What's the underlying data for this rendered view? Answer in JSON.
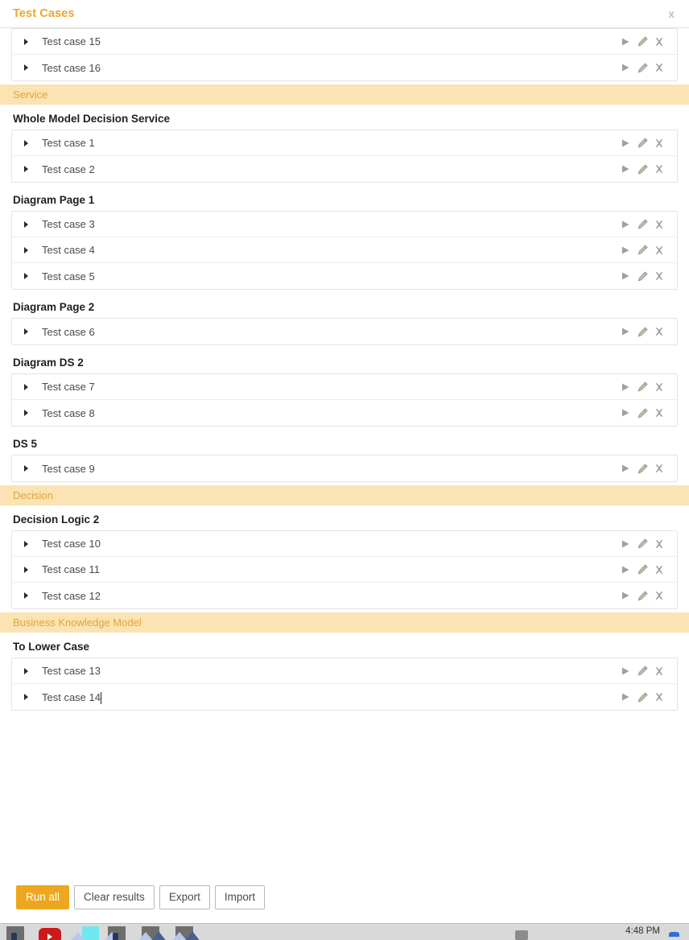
{
  "panel": {
    "title": "Test Cases",
    "close_label": "x"
  },
  "top_cases": [
    {
      "name": "Test case 15",
      "editing": false
    },
    {
      "name": "Test case 16",
      "editing": false
    }
  ],
  "row_actions": {
    "run": "run-icon",
    "edit": "edit-icon",
    "delete": "delete-icon"
  },
  "sections": [
    {
      "category": "Service",
      "groups": [
        {
          "heading": "Whole Model Decision Service",
          "cases": [
            {
              "name": "Test case 1",
              "editing": false
            },
            {
              "name": "Test case 2",
              "editing": false
            }
          ]
        },
        {
          "heading": "Diagram Page 1",
          "cases": [
            {
              "name": "Test case 3",
              "editing": false
            },
            {
              "name": "Test case 4",
              "editing": false
            },
            {
              "name": "Test case 5",
              "editing": false
            }
          ]
        },
        {
          "heading": "Diagram Page 2",
          "cases": [
            {
              "name": "Test case 6",
              "editing": false
            }
          ]
        },
        {
          "heading": "Diagram DS 2",
          "cases": [
            {
              "name": "Test case 7",
              "editing": false
            },
            {
              "name": "Test case 8",
              "editing": false
            }
          ]
        },
        {
          "heading": "DS 5",
          "cases": [
            {
              "name": "Test case 9",
              "editing": false
            }
          ]
        }
      ]
    },
    {
      "category": "Decision",
      "groups": [
        {
          "heading": "Decision Logic 2",
          "cases": [
            {
              "name": "Test case 10",
              "editing": false
            },
            {
              "name": "Test case 11",
              "editing": false
            },
            {
              "name": "Test case 12",
              "editing": false
            }
          ]
        }
      ]
    },
    {
      "category": "Business Knowledge Model",
      "groups": [
        {
          "heading": "To Lower Case",
          "cases": [
            {
              "name": "Test case 13",
              "editing": false
            },
            {
              "name": "Test case 14",
              "editing": true
            }
          ]
        }
      ]
    }
  ],
  "footer": {
    "run_all": "Run all",
    "clear_results": "Clear results",
    "export": "Export",
    "import": "Import"
  },
  "taskbar": {
    "clock": "4:48 PM"
  },
  "colors": {
    "accent": "#efa429",
    "band_bg": "#fbe3b3",
    "band_text": "#e3a33a",
    "primary_button": "#eda71f",
    "row_border": "#e3e3e3",
    "heading_text": "#1f1f22"
  }
}
